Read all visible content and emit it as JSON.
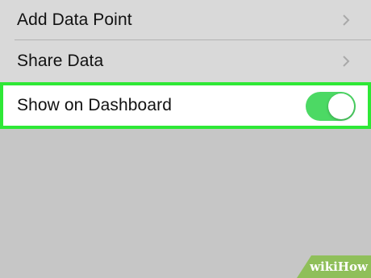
{
  "settings": {
    "rows": [
      {
        "label": "Add Data Point",
        "icon": "chevron-right-icon"
      },
      {
        "label": "Share Data",
        "icon": "chevron-right-icon"
      }
    ],
    "dashboard": {
      "label": "Show on Dashboard",
      "toggle_on": true,
      "toggle_color": "#4cd964",
      "highlight_color": "#2ee836"
    }
  },
  "watermark": {
    "part1": "wiki",
    "part2": "How",
    "color": "#8fbf5a"
  }
}
